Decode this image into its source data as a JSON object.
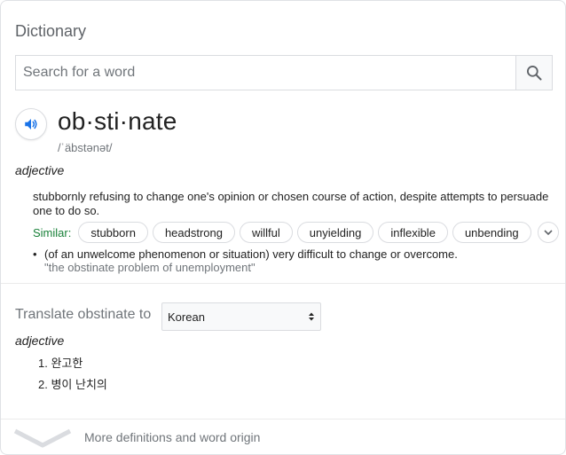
{
  "header": {
    "title": "Dictionary"
  },
  "search": {
    "placeholder": "Search for a word",
    "value": ""
  },
  "entry": {
    "word": "ob·sti·nate",
    "phonetic": "/ˈäbstənət/",
    "part_of_speech": "adjective",
    "definitions": [
      {
        "text": "stubbornly refusing to change one's opinion or chosen course of action, despite attempts to persuade one to do so.",
        "similar_label": "Similar:",
        "similar": [
          "stubborn",
          "headstrong",
          "willful",
          "unyielding",
          "inflexible",
          "unbending"
        ]
      },
      {
        "bullet": "•",
        "text": "(of an unwelcome phenomenon or situation) very difficult to change or overcome.",
        "example": "\"the obstinate problem of unemployment\""
      }
    ]
  },
  "translate": {
    "label": "Translate obstinate to",
    "language": "Korean",
    "part_of_speech": "adjective",
    "items": [
      "1. 완고한",
      "2. 병이 난치의"
    ]
  },
  "footer": {
    "more_label": "More definitions and word origin"
  },
  "icons": {
    "search": "search-icon",
    "speaker": "speaker-icon",
    "similar_more": "chevron-down-icon",
    "select_arrows": "select-arrows-icon",
    "footer_chevron": "chevron-down-icon"
  },
  "colors": {
    "accent_blue": "#1a73e8",
    "similar_green": "#188038",
    "muted": "#70757a"
  }
}
